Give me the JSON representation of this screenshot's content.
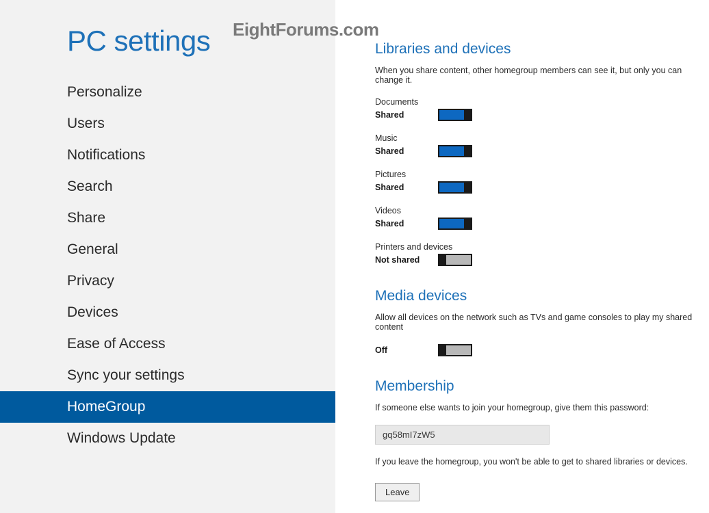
{
  "watermark": "EightForums.com",
  "sidebar": {
    "title": "PC settings",
    "items": [
      {
        "label": "Personalize",
        "active": false
      },
      {
        "label": "Users",
        "active": false
      },
      {
        "label": "Notifications",
        "active": false
      },
      {
        "label": "Search",
        "active": false
      },
      {
        "label": "Share",
        "active": false
      },
      {
        "label": "General",
        "active": false
      },
      {
        "label": "Privacy",
        "active": false
      },
      {
        "label": "Devices",
        "active": false
      },
      {
        "label": "Ease of Access",
        "active": false
      },
      {
        "label": "Sync your settings",
        "active": false
      },
      {
        "label": "HomeGroup",
        "active": true
      },
      {
        "label": "Windows Update",
        "active": false
      }
    ]
  },
  "main": {
    "libraries": {
      "title": "Libraries and devices",
      "desc": "When you share content, other homegroup members can see it, but only you can change it.",
      "toggles": [
        {
          "label": "Documents",
          "state": "Shared",
          "on": true
        },
        {
          "label": "Music",
          "state": "Shared",
          "on": true
        },
        {
          "label": "Pictures",
          "state": "Shared",
          "on": true
        },
        {
          "label": "Videos",
          "state": "Shared",
          "on": true
        },
        {
          "label": "Printers and devices",
          "state": "Not shared",
          "on": false
        }
      ]
    },
    "media": {
      "title": "Media devices",
      "desc": "Allow all devices on the network such as TVs and game consoles to play my shared content",
      "state": "Off",
      "on": false
    },
    "membership": {
      "title": "Membership",
      "join_desc": "If someone else wants to join your homegroup, give them this password:",
      "password": "gq58mI7zW5",
      "leave_desc": "If you leave the homegroup, you won't be able to get to shared libraries or devices.",
      "leave_label": "Leave"
    }
  }
}
